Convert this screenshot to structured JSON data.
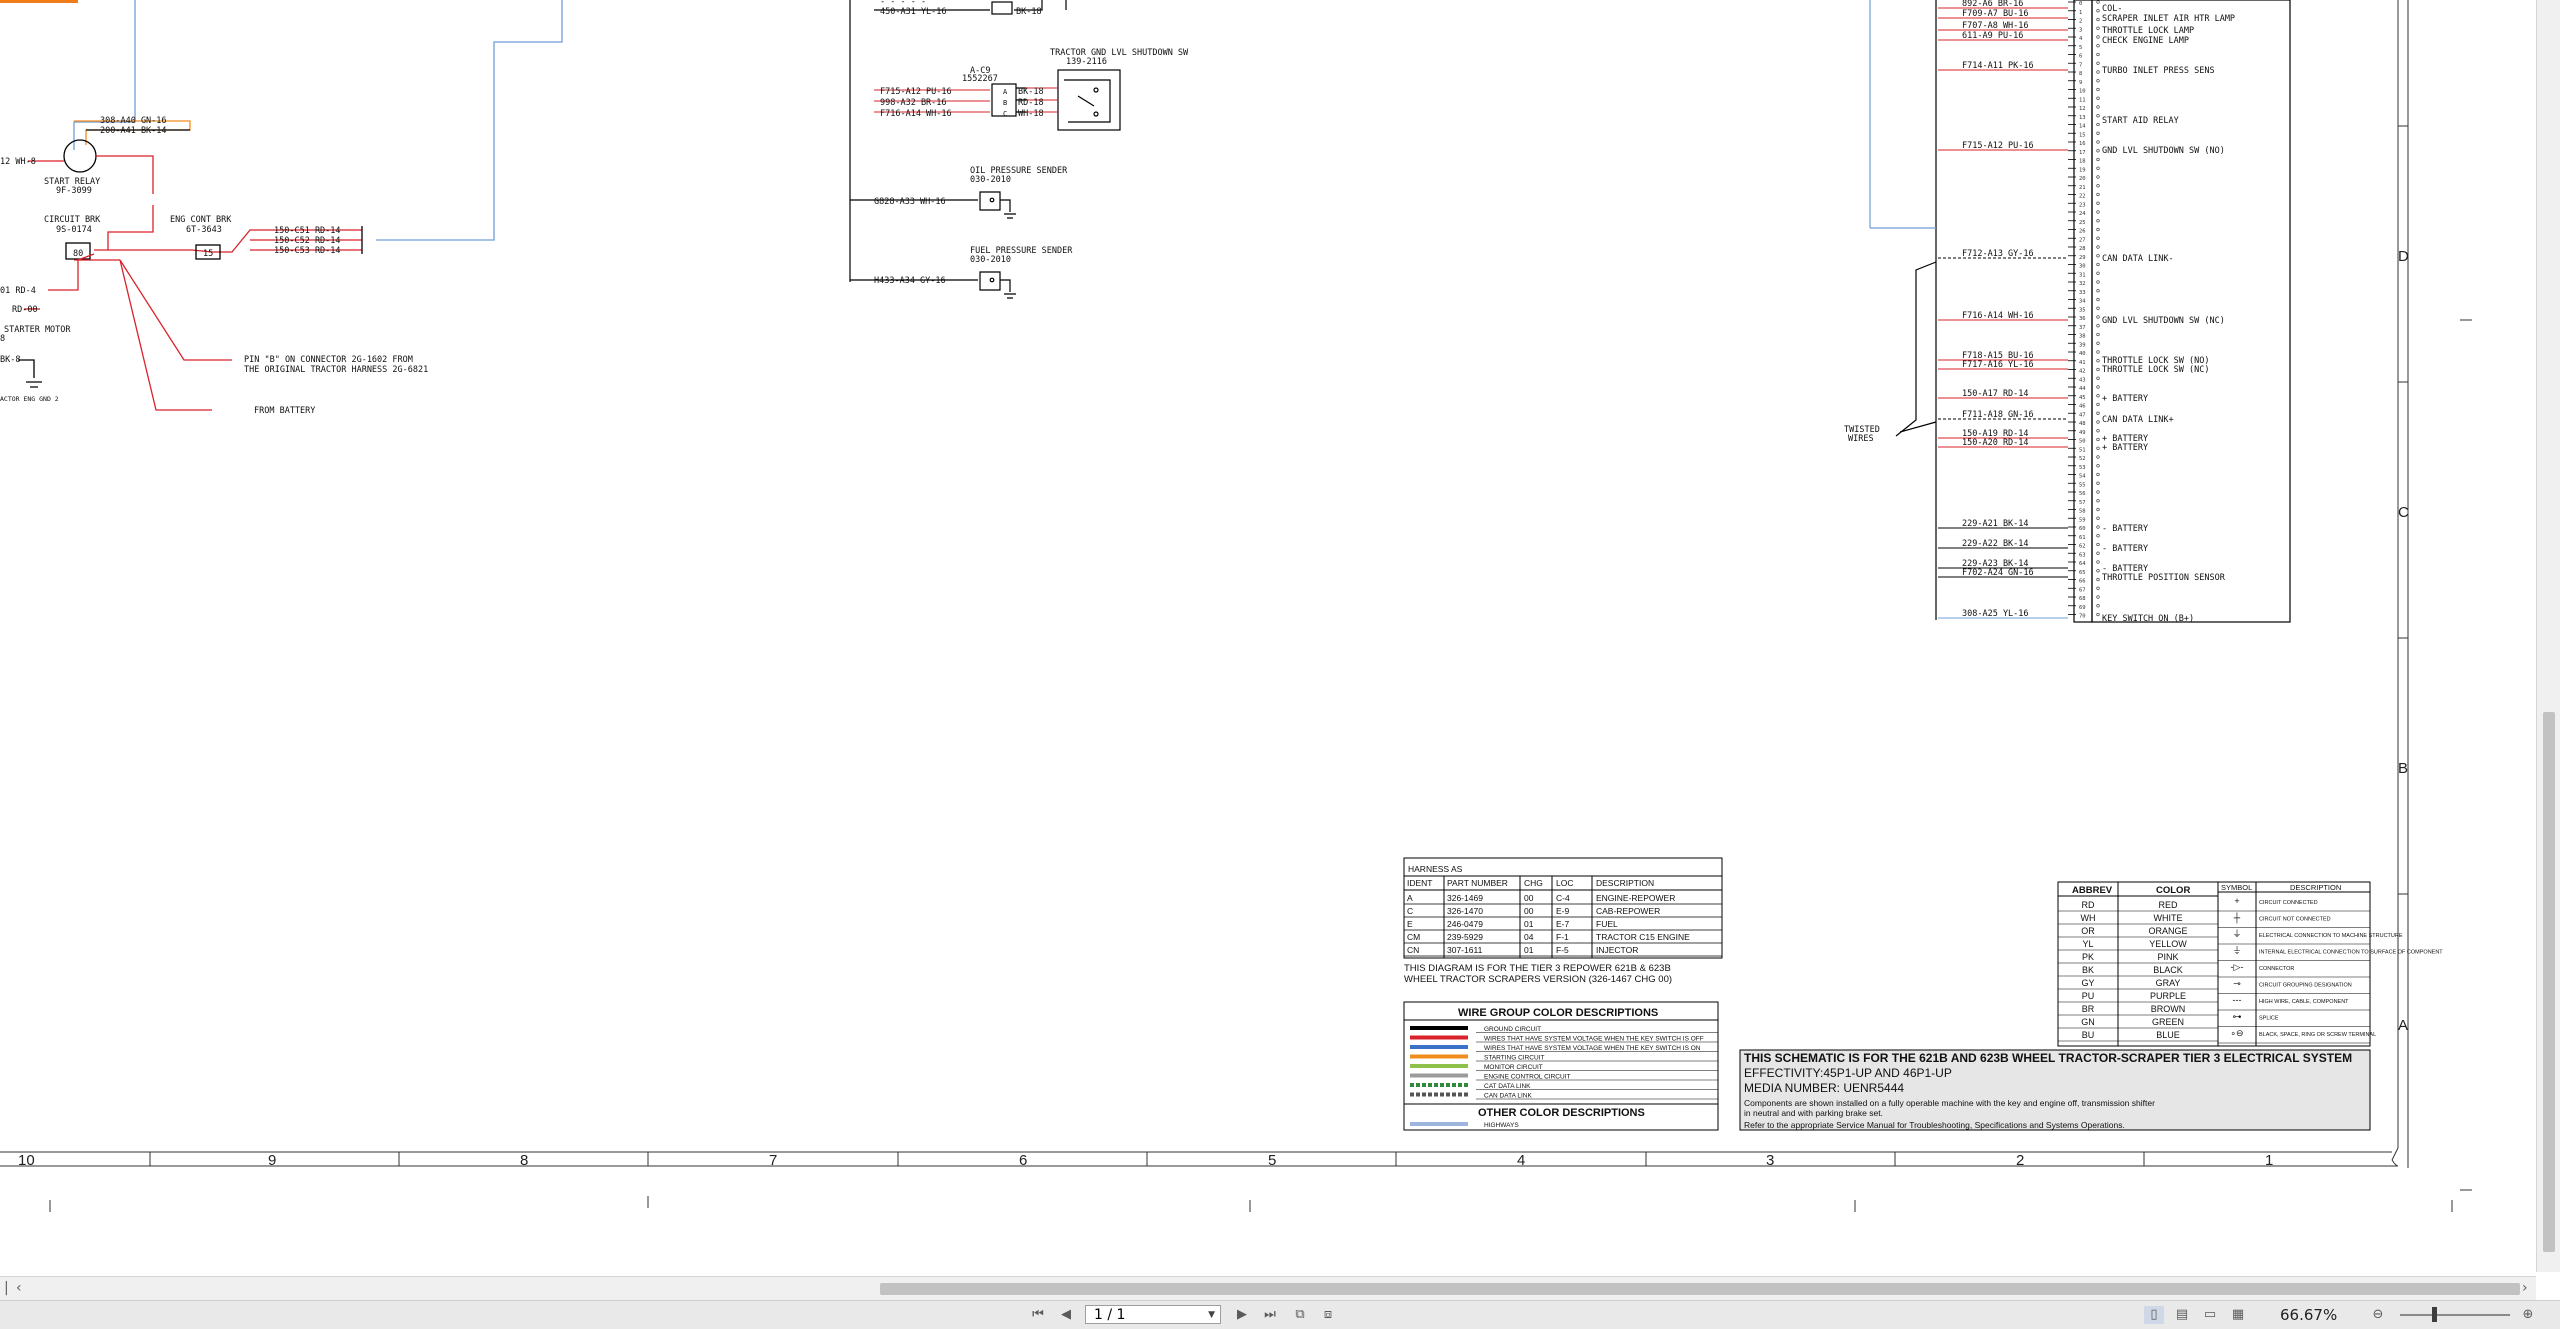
{
  "colors": {
    "red": "#d9222a",
    "orange": "#f08c1e",
    "blue": "#6f9ed8",
    "black": "#000000",
    "gray": "#8c8c8c"
  },
  "grid": {
    "columns": [
      "10",
      "9",
      "8",
      "7",
      "6",
      "5",
      "4",
      "3",
      "2",
      "1"
    ],
    "rows": [
      "D",
      "C",
      "B",
      "A"
    ]
  },
  "left_section": {
    "start_relay_wires": [
      "308-A40 GN-16",
      "200-A41 BK-14"
    ],
    "wire_12": "12  WH-8",
    "start_relay_title": "START RELAY",
    "start_relay_part": "9F-3099",
    "circuit_brk_title": "CIRCUIT BRK",
    "circuit_brk_part": "9S-0174",
    "circuit_brk_rating": "80",
    "eng_cont_brk_title": "ENG CONT BRK",
    "eng_cont_brk_part": "6T-3643",
    "eng_cont_brk_rating": "15",
    "brk_wires": [
      "150-C51 RD-14",
      "150-C52 RD-14",
      "150-C53 RD-14"
    ],
    "wire_01": "01  RD-4",
    "wire_rd00": "RD-00",
    "starter_motor": "STARTER MOTOR",
    "starter_num": "8",
    "wire_bk": "BK-8",
    "ground_label": "ACTOR ENG GND 2",
    "pin_note_1": "PIN \"B\" ON CONNECTOR 2G-1602 FROM",
    "pin_note_2": "THE ORIGINAL TRACTOR HARNESS 2G-6821",
    "from_battery": "FROM BATTERY"
  },
  "mid_section": {
    "top_wires": [
      "- - -  - -",
      "450-A31  YL-16"
    ],
    "top_right": "BK-18",
    "gnd_lvl_title": "TRACTOR GND LVL SHUTDOWN SW",
    "gnd_lvl_part": "139-2116",
    "conn_name": "A-C9",
    "conn_part": "1552267",
    "conn_left_wires": [
      "F715-A12  PU-16",
      "998-A32  BR-16",
      "F716-A14  WH-16"
    ],
    "conn_pins": [
      "A",
      "B",
      "C"
    ],
    "conn_right_wires": [
      "BK-18",
      "RD-18",
      "WH-18"
    ],
    "oil_title": "OIL PRESSURE SENDER",
    "oil_part": "030-2010",
    "oil_wire": "G828-A33  WH-16",
    "fuel_title": "FUEL PRESSURE SENDER",
    "fuel_part": "030-2010",
    "fuel_wire": "H433-A34  GY-16"
  },
  "right_connector": {
    "pins": [
      {
        "num": "8",
        "wire": "892-A6   BR-16",
        "desc": "COL-"
      },
      {
        "num": "9",
        "wire": "F709-A7  BU-16",
        "desc": "SCRAPER INLET AIR HTR LAMP"
      },
      {
        "num": "11",
        "wire": "F707-A8  WH-16",
        "desc": "THROTTLE LOCK LAMP"
      },
      {
        "num": "16",
        "wire": "611-A9   PU-16",
        "desc": "CHECK ENGINE LAMP"
      },
      {
        "num": "18",
        "wire": "F714-A11  PK-16",
        "desc": "TURBO INLET PRESS SENS"
      },
      {
        "num": "20",
        "wire": "",
        "desc": "START AID RELAY"
      },
      {
        "num": "22",
        "wire": "F715-A12  PU-16",
        "desc": "GND LVL SHUTDOWN SW (NO)"
      },
      {
        "num": "34",
        "wire": "F712-A13  GY-16",
        "desc": "CAN DATA LINK-"
      },
      {
        "num": "40",
        "wire": "F716-A14  WH-16",
        "desc": "GND LVL SHUTDOWN SW (NC)"
      },
      {
        "num": "44",
        "wire": "F718-A15  BU-16",
        "desc": "THROTTLE LOCK SW (NO)"
      },
      {
        "num": "45",
        "wire": "F717-A16  YL-16",
        "desc": "THROTTLE LOCK SW (NC)"
      },
      {
        "num": "48",
        "wire": "150-A17  RD-14",
        "desc": "+ BATTERY"
      },
      {
        "num": "50",
        "wire": "F711-A18  GN-16",
        "desc": "CAN DATA LINK+"
      },
      {
        "num": "52",
        "wire": "150-A19  RD-14",
        "desc": "+ BATTERY"
      },
      {
        "num": "53",
        "wire": "150-A20  RD-14",
        "desc": "+ BATTERY"
      },
      {
        "num": "61",
        "wire": "229-A21  BK-14",
        "desc": "- BATTERY"
      },
      {
        "num": "63",
        "wire": "229-A22  BK-14",
        "desc": "- BATTERY"
      },
      {
        "num": "65",
        "wire": "229-A23  BK-14",
        "desc": "- BATTERY"
      },
      {
        "num": "66",
        "wire": "F702-A24  GN-16",
        "desc": "THROTTLE POSITION SENSOR"
      },
      {
        "num": "70",
        "wire": "308-A25  YL-16",
        "desc": "KEY SWITCH ON (B+)"
      }
    ],
    "twisted_1": "TWISTED",
    "twisted_2": "WIRES"
  },
  "harness_table": {
    "title": "HARNESS AS",
    "headers": [
      "IDENT",
      "PART NUMBER",
      "CHG",
      "LOC",
      "DESCRIPTION"
    ],
    "rows": [
      [
        "A",
        "326-1469",
        "00",
        "C-4",
        "ENGINE-REPOWER"
      ],
      [
        "C",
        "326-1470",
        "00",
        "E-9",
        "CAB-REPOWER"
      ],
      [
        "E",
        "246-0479",
        "01",
        "E-7",
        "FUEL"
      ],
      [
        "CM",
        "239-5929",
        "04",
        "F-1",
        "TRACTOR C15 ENGINE"
      ],
      [
        "CN",
        "307-1611",
        "01",
        "F-5",
        "INJECTOR"
      ]
    ],
    "note_1": "THIS DIAGRAM IS FOR THE TIER 3 REPOWER 621B & 623B",
    "note_2": "WHEEL TRACTOR SCRAPERS VERSION (326-1467 CHG 00)"
  },
  "wire_group": {
    "title": "WIRE GROUP COLOR DESCRIPTIONS",
    "rows": [
      {
        "color": "#000000",
        "label": "GROUND CIRCUIT"
      },
      {
        "color": "#d9222a",
        "label": "WIRES THAT HAVE SYSTEM VOLTAGE WHEN THE KEY SWITCH IS OFF"
      },
      {
        "color": "#3a72c8",
        "label": "WIRES THAT HAVE SYSTEM VOLTAGE WHEN THE KEY SWITCH IS ON"
      },
      {
        "color": "#f08c1e",
        "label": "STARTING CIRCUIT"
      },
      {
        "color": "#8fc14a",
        "label": "MONITOR CIRCUIT"
      },
      {
        "color": "#9b9b9b",
        "label": "ENGINE CONTROL CIRCUIT"
      },
      {
        "color": "hatch-green",
        "label": "CAT DATA LINK"
      },
      {
        "color": "hatch-gray",
        "label": "CAN DATA LINK"
      }
    ],
    "other_title": "OTHER COLOR DESCRIPTIONS",
    "other_rows": [
      {
        "color": "#9db4dc",
        "label": "HIGHWAYS"
      }
    ]
  },
  "color_table": {
    "headers": [
      "ABBREV",
      "COLOR"
    ],
    "rows": [
      [
        "RD",
        "RED"
      ],
      [
        "WH",
        "WHITE"
      ],
      [
        "OR",
        "ORANGE"
      ],
      [
        "YL",
        "YELLOW"
      ],
      [
        "PK",
        "PINK"
      ],
      [
        "BK",
        "BLACK"
      ],
      [
        "GY",
        "GRAY"
      ],
      [
        "PU",
        "PURPLE"
      ],
      [
        "BR",
        "BROWN"
      ],
      [
        "GN",
        "GREEN"
      ],
      [
        "BU",
        "BLUE"
      ]
    ]
  },
  "symbol_table": {
    "headers": [
      "SYMBOL",
      "DESCRIPTION"
    ],
    "rows": [
      "CIRCUIT CONNECTED",
      "CIRCUIT NOT CONNECTED",
      "ELECTRICAL CONNECTION TO MACHINE STRUCTURE",
      "INTERNAL ELECTRICAL CONNECTION TO SURFACE OF COMPONENT",
      "CONNECTOR",
      "CIRCUIT GROUPING DESIGNATION",
      "HIGH WIRE, CABLE, COMPONENT",
      "SPLICE",
      "BLACK, SPACE, RING OR SCREW TERMINAL"
    ]
  },
  "title_block": {
    "line1": "THIS SCHEMATIC IS FOR THE 621B AND 623B WHEEL TRACTOR-SCRAPER TIER 3 ELECTRICAL SYSTEM",
    "line2": "EFFECTIVITY:45P1-UP AND 46P1-UP",
    "line3": "MEDIA NUMBER: UENR5444",
    "line4": "Components are shown installed on a fully operable machine with the key and engine off, transmission shifter",
    "line5": "in neutral and with parking brake set.",
    "line6": "Refer to the appropriate Service Manual for Troubleshooting, Specifications and Systems Operations."
  },
  "toolbar": {
    "page_value": "1 / 1",
    "zoom": "66.67%",
    "icons": [
      "first-page-icon",
      "prev-page-icon",
      "next-page-icon",
      "last-page-icon",
      "fit-page-icon",
      "fit-width-icon",
      "single-page-icon",
      "continuous-icon",
      "facing-icon",
      "facing-continuous-icon",
      "zoom-out-icon",
      "zoom-in-icon"
    ]
  }
}
